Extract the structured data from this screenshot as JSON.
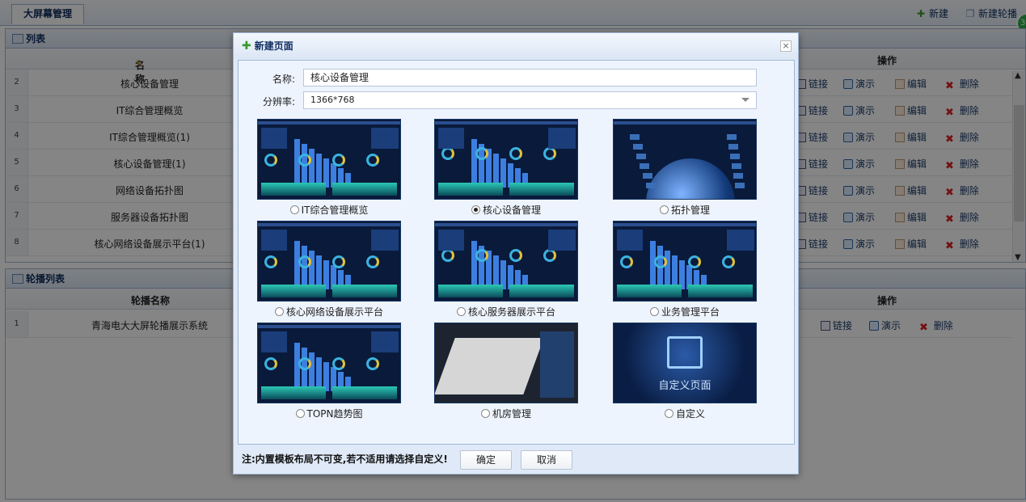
{
  "topbar": {
    "tab": "大屏幕管理",
    "new_label": "新建",
    "new_carousel_label": "新建轮播",
    "badge": "3"
  },
  "list_panel": {
    "title": "列表",
    "col_name": "名称",
    "col_action": "操作",
    "rows": [
      {
        "num": "2",
        "name": "核心设备管理"
      },
      {
        "num": "3",
        "name": "IT综合管理概览"
      },
      {
        "num": "4",
        "name": "IT综合管理概览(1)"
      },
      {
        "num": "5",
        "name": "核心设备管理(1)"
      },
      {
        "num": "6",
        "name": "网络设备拓扑图"
      },
      {
        "num": "7",
        "name": "服务器设备拓扑图"
      },
      {
        "num": "8",
        "name": "核心网络设备展示平台(1)"
      }
    ],
    "actions": {
      "link": "链接",
      "demo": "演示",
      "edit": "编辑",
      "delete": "删除"
    }
  },
  "carousel_panel": {
    "title": "轮播列表",
    "col_name": "轮播名称",
    "col_action": "操作",
    "rows": [
      {
        "num": "1",
        "name": "青海电大大屏轮播展示系统"
      }
    ],
    "actions": {
      "link": "链接",
      "demo": "演示",
      "delete": "删除"
    }
  },
  "dialog": {
    "title": "新建页面",
    "close": "×",
    "name_label": "名称:",
    "name_value": "核心设备管理",
    "res_label": "分辨率:",
    "res_value": "1366*768",
    "templates": [
      {
        "label": "IT综合管理概览",
        "selected": false
      },
      {
        "label": "核心设备管理",
        "selected": true
      },
      {
        "label": "拓扑管理",
        "selected": false
      },
      {
        "label": "核心网络设备展示平台",
        "selected": false
      },
      {
        "label": "核心服务器展示平台",
        "selected": false
      },
      {
        "label": "业务管理平台",
        "selected": false
      },
      {
        "label": "TOPN趋势图",
        "selected": false
      },
      {
        "label": "机房管理",
        "selected": false
      },
      {
        "label": "自定义",
        "selected": false
      }
    ],
    "custom_thumb_text": "自定义页面",
    "note": "注:内置模板布局不可变,若不适用请选择自定义!",
    "ok": "确定",
    "cancel": "取消"
  }
}
